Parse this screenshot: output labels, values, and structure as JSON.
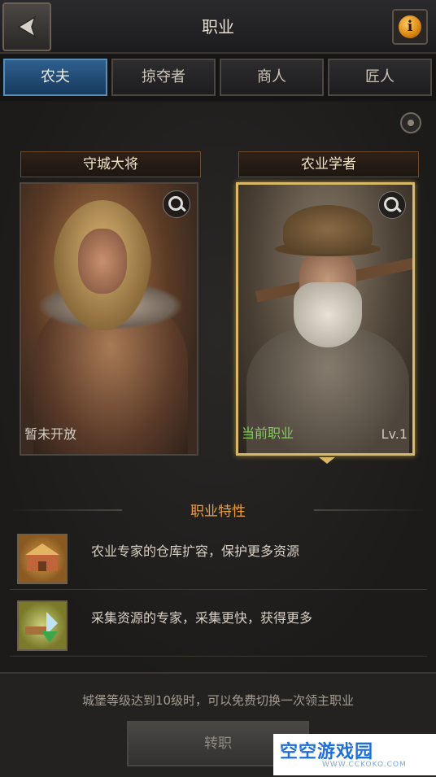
{
  "header": {
    "title": "职业"
  },
  "tabs": [
    {
      "label": "农夫",
      "active": true
    },
    {
      "label": "掠夺者",
      "active": false
    },
    {
      "label": "商人",
      "active": false
    },
    {
      "label": "匠人",
      "active": false
    }
  ],
  "professions": [
    {
      "name": "守城大将",
      "status": "暂未开放",
      "level": ""
    },
    {
      "name": "农业学者",
      "status": "当前职业",
      "level": "Lv.1"
    }
  ],
  "traits": {
    "title": "职业特性",
    "items": [
      {
        "text": "农业专家的仓库扩容，保护更多资源",
        "icon": "warehouse-icon"
      },
      {
        "text": "采集资源的专家，采集更快，获得更多",
        "icon": "resources-icon"
      }
    ]
  },
  "footer": {
    "hint": "城堡等级达到10级时，可以免费切换一次领主职业",
    "switch_label": "转职"
  },
  "watermark": {
    "text": "空空游戏园",
    "sub": "WWW.CCKOKO.COM"
  },
  "colors": {
    "accent_tab": "#2f5f8f",
    "gold": "#d9b866",
    "current": "#86c95f",
    "trait_title": "#e8a040"
  }
}
